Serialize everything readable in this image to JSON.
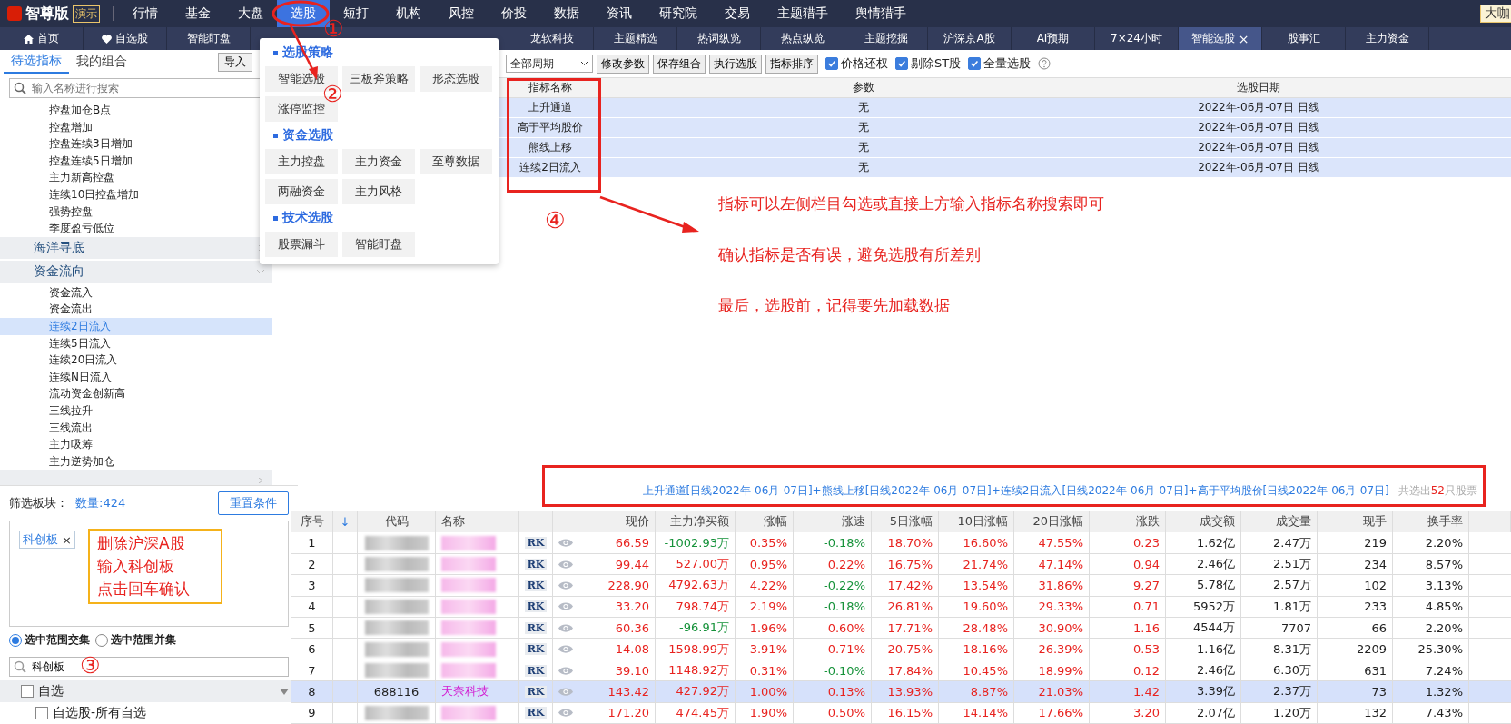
{
  "menu": {
    "logo": "智尊版",
    "badge": "演示",
    "items": [
      {
        "label": "行情",
        "selected": false
      },
      {
        "label": "基金",
        "selected": false
      },
      {
        "label": "大盘",
        "selected": false
      },
      {
        "label": "选股",
        "selected": true
      },
      {
        "label": "短打",
        "selected": false
      },
      {
        "label": "机构",
        "selected": false
      },
      {
        "label": "风控",
        "selected": false
      },
      {
        "label": "价投",
        "selected": false
      },
      {
        "label": "数据",
        "selected": false
      },
      {
        "label": "资讯",
        "selected": false
      },
      {
        "label": "研究院",
        "selected": false
      },
      {
        "label": "交易",
        "selected": false
      },
      {
        "label": "主题猎手",
        "selected": false
      },
      {
        "label": "舆情猎手",
        "selected": false
      }
    ],
    "right_badge": "大咖"
  },
  "tabs": [
    {
      "label": "首页",
      "kind": "home",
      "selected": false
    },
    {
      "label": "自选股",
      "kind": "heart",
      "selected": false
    },
    {
      "label": "智能盯盘",
      "kind": "plain",
      "selected": false
    },
    {
      "label": "龙软科技",
      "kind": "plain",
      "selected": false
    },
    {
      "label": "主题精选",
      "kind": "plain",
      "selected": false
    },
    {
      "label": "热词纵览",
      "kind": "plain",
      "selected": false
    },
    {
      "label": "热点纵览",
      "kind": "plain",
      "selected": false
    },
    {
      "label": "主题挖掘",
      "kind": "plain",
      "selected": false
    },
    {
      "label": "沪深京A股",
      "kind": "plain",
      "selected": false
    },
    {
      "label": "AI预期",
      "kind": "plain",
      "selected": false
    },
    {
      "label": "7×24小时",
      "kind": "plain",
      "selected": false
    },
    {
      "label": "智能选股",
      "kind": "plain",
      "selected": true,
      "close": "×"
    },
    {
      "label": "股事汇",
      "kind": "plain",
      "selected": false
    },
    {
      "label": "主力资金",
      "kind": "plain",
      "selected": false
    }
  ],
  "dropdown": {
    "sections": [
      {
        "title": "选股策略",
        "items": [
          "智能选股",
          "三板斧策略",
          "形态选股",
          "涨停监控"
        ]
      },
      {
        "title": "资金选股",
        "items": [
          "主力控盘",
          "主力资金",
          "至尊数据",
          "两融资金",
          "主力风格"
        ]
      },
      {
        "title": "技术选股",
        "items": [
          "股票漏斗",
          "智能盯盘"
        ]
      }
    ]
  },
  "left_panel": {
    "tabs": [
      {
        "label": "待选指标",
        "selected": true
      },
      {
        "label": "我的组合",
        "selected": false
      }
    ],
    "import_button": "导入",
    "search": {
      "placeholder": "输入名称进行搜索"
    },
    "tree": {
      "items": [
        {
          "label": "控盘加仓B点",
          "selected": false
        },
        {
          "label": "控盘增加",
          "selected": false
        },
        {
          "label": "控盘连续3日增加",
          "selected": false
        },
        {
          "label": "控盘连续5日增加",
          "selected": false
        },
        {
          "label": "主力新高控盘",
          "selected": false
        },
        {
          "label": "连续10日控盘增加",
          "selected": false
        },
        {
          "label": "强势控盘",
          "selected": false
        },
        {
          "label": "季度盈亏低位",
          "selected": false
        }
      ],
      "groups": [
        {
          "label": "海洋寻底",
          "expanded": false
        },
        {
          "label": "资金流向",
          "expanded": true,
          "children": [
            {
              "label": "资金流入",
              "selected": false
            },
            {
              "label": "资金流出",
              "selected": false
            },
            {
              "label": "连续2日流入",
              "selected": true
            },
            {
              "label": "连续5日流入",
              "selected": false
            },
            {
              "label": "连续20日流入",
              "selected": false
            },
            {
              "label": "连续N日流入",
              "selected": false
            },
            {
              "label": "流动资金创新高",
              "selected": false
            },
            {
              "label": "三线拉升",
              "selected": false
            },
            {
              "label": "三线流出",
              "selected": false
            },
            {
              "label": "主力吸筹",
              "selected": false
            },
            {
              "label": "主力逆势加仓",
              "selected": false
            }
          ]
        },
        {
          "expanded": false
        }
      ]
    },
    "filter": {
      "label": "筛选板块：",
      "count": "数量:424",
      "reset_button": "重置条件",
      "tags": [
        {
          "label": "科创板",
          "remove": "×"
        }
      ],
      "note": [
        "删除沪深A股",
        "输入科创板",
        "点击回车确认"
      ],
      "radios": [
        {
          "label": "选中范围交集",
          "selected": true
        },
        {
          "label": "选中范围并集",
          "selected": false
        }
      ],
      "search": {
        "value": "科创板"
      },
      "list": [
        {
          "label": "自选",
          "kind": "group",
          "checked": false
        },
        {
          "label": "自选股-所有自选",
          "kind": "item",
          "checked": false
        }
      ]
    }
  },
  "toolbar": {
    "period": "全部周期",
    "buttons": [
      "修改参数",
      "保存组合",
      "执行选股",
      "指标排序"
    ],
    "checkboxes": [
      {
        "label": "价格还权",
        "checked": true
      },
      {
        "label": "剔除ST股",
        "checked": true
      },
      {
        "label": "全量选股",
        "checked": true
      }
    ]
  },
  "indicator_table": {
    "columns": [
      "指标名称",
      "参数",
      "选股日期"
    ],
    "rows": [
      {
        "name": "上升通道",
        "param": "无",
        "date": "2022年-06月-07日 日线"
      },
      {
        "name": "高于平均股价",
        "param": "无",
        "date": "2022年-06月-07日 日线"
      },
      {
        "name": "熊线上移",
        "param": "无",
        "date": "2022年-06月-07日 日线"
      },
      {
        "name": "连续2日流入",
        "param": "无",
        "date": "2022年-06月-07日 日线"
      }
    ]
  },
  "annotations": {
    "markers": [
      "①",
      "②",
      "③",
      "④"
    ],
    "notes": [
      "指标可以左侧栏目勾选或直接上方输入指标名称搜索即可",
      "确认指标是否有误，避免选股有所差别",
      "最后，选股前，记得要先加载数据"
    ]
  },
  "formula": {
    "text": "上升通道[日线2022年-06月-07日]+熊线上移[日线2022年-06月-07日]+连续2日流入[日线2022年-06月-07日]+高于平均股价[日线2022年-06月-07日]",
    "result_prefix": "共选出",
    "result_count": "52",
    "result_suffix": "只股票"
  },
  "table": {
    "columns": [
      {
        "label": "序号",
        "kind": "index"
      },
      {
        "label": "↓",
        "kind": "sort"
      },
      {
        "label": "代码",
        "kind": "code"
      },
      {
        "label": "名称",
        "kind": "name"
      },
      {
        "kind": "badge"
      },
      {
        "kind": "eye"
      },
      {
        "label": "现价",
        "kind": "rise"
      },
      {
        "label": "主力净买额",
        "kind": "flow"
      },
      {
        "label": "涨幅",
        "kind": "rise"
      },
      {
        "label": "涨速",
        "kind": "speed"
      },
      {
        "label": "5日涨幅",
        "kind": "rise"
      },
      {
        "label": "10日涨幅",
        "kind": "rise"
      },
      {
        "label": "20日涨幅",
        "kind": "rise"
      },
      {
        "label": "涨跌",
        "kind": "rise"
      },
      {
        "label": "成交额",
        "kind": "plain"
      },
      {
        "label": "成交量",
        "kind": "plain"
      },
      {
        "label": "现手",
        "kind": "plain"
      },
      {
        "label": "换手率",
        "kind": "plain"
      }
    ],
    "rows": [
      {
        "index": "1",
        "selected": false,
        "badge": "RK",
        "flow_down": true,
        "speed_down": true,
        "values": [
          "66.59",
          "-1002.93万",
          "0.35%",
          "-0.18%",
          "18.70%",
          "16.60%",
          "47.55%",
          "0.23",
          "1.62亿",
          "2.47万",
          "219",
          "2.20%"
        ]
      },
      {
        "index": "2",
        "selected": false,
        "badge": "RK",
        "flow_down": false,
        "speed_down": false,
        "values": [
          "99.44",
          "527.00万",
          "0.95%",
          "0.22%",
          "16.75%",
          "21.74%",
          "47.14%",
          "0.94",
          "2.46亿",
          "2.51万",
          "234",
          "8.57%"
        ]
      },
      {
        "index": "3",
        "selected": false,
        "badge": "RK",
        "flow_down": false,
        "speed_down": true,
        "values": [
          "228.90",
          "4792.63万",
          "4.22%",
          "-0.22%",
          "17.42%",
          "13.54%",
          "31.86%",
          "9.27",
          "5.78亿",
          "2.57万",
          "102",
          "3.13%"
        ]
      },
      {
        "index": "4",
        "selected": false,
        "badge": "RK",
        "flow_down": false,
        "speed_down": true,
        "values": [
          "33.20",
          "798.74万",
          "2.19%",
          "-0.18%",
          "26.81%",
          "19.60%",
          "29.33%",
          "0.71",
          "5952万",
          "1.81万",
          "233",
          "4.85%"
        ]
      },
      {
        "index": "5",
        "selected": false,
        "badge": "RK",
        "flow_down": true,
        "speed_down": false,
        "values": [
          "60.36",
          "-96.91万",
          "1.96%",
          "0.60%",
          "17.71%",
          "28.48%",
          "30.90%",
          "1.16",
          "4544万",
          "7707",
          "66",
          "2.20%"
        ]
      },
      {
        "index": "6",
        "selected": false,
        "badge": "RK",
        "flow_down": false,
        "speed_down": false,
        "values": [
          "14.08",
          "1598.99万",
          "3.91%",
          "0.71%",
          "20.75%",
          "18.16%",
          "26.39%",
          "0.53",
          "1.16亿",
          "8.31万",
          "2209",
          "25.30%"
        ]
      },
      {
        "index": "7",
        "selected": false,
        "badge": "RK",
        "flow_down": false,
        "speed_down": true,
        "values": [
          "39.10",
          "1148.92万",
          "0.31%",
          "-0.10%",
          "17.84%",
          "10.45%",
          "18.99%",
          "0.12",
          "2.46亿",
          "6.30万",
          "631",
          "7.24%"
        ]
      },
      {
        "index": "8",
        "selected": true,
        "code": "688116",
        "name": "天奈科技",
        "badge": "RK",
        "flow_down": false,
        "speed_down": false,
        "values": [
          "143.42",
          "427.92万",
          "1.00%",
          "0.13%",
          "13.93%",
          "8.87%",
          "21.03%",
          "1.42",
          "3.39亿",
          "2.37万",
          "73",
          "1.32%"
        ]
      },
      {
        "index": "9",
        "selected": false,
        "badge": "RK",
        "flow_down": false,
        "speed_down": false,
        "values": [
          "171.20",
          "474.45万",
          "1.90%",
          "0.50%",
          "16.15%",
          "14.14%",
          "17.66%",
          "3.20",
          "2.07亿",
          "1.20万",
          "132",
          "7.43%"
        ]
      }
    ]
  }
}
